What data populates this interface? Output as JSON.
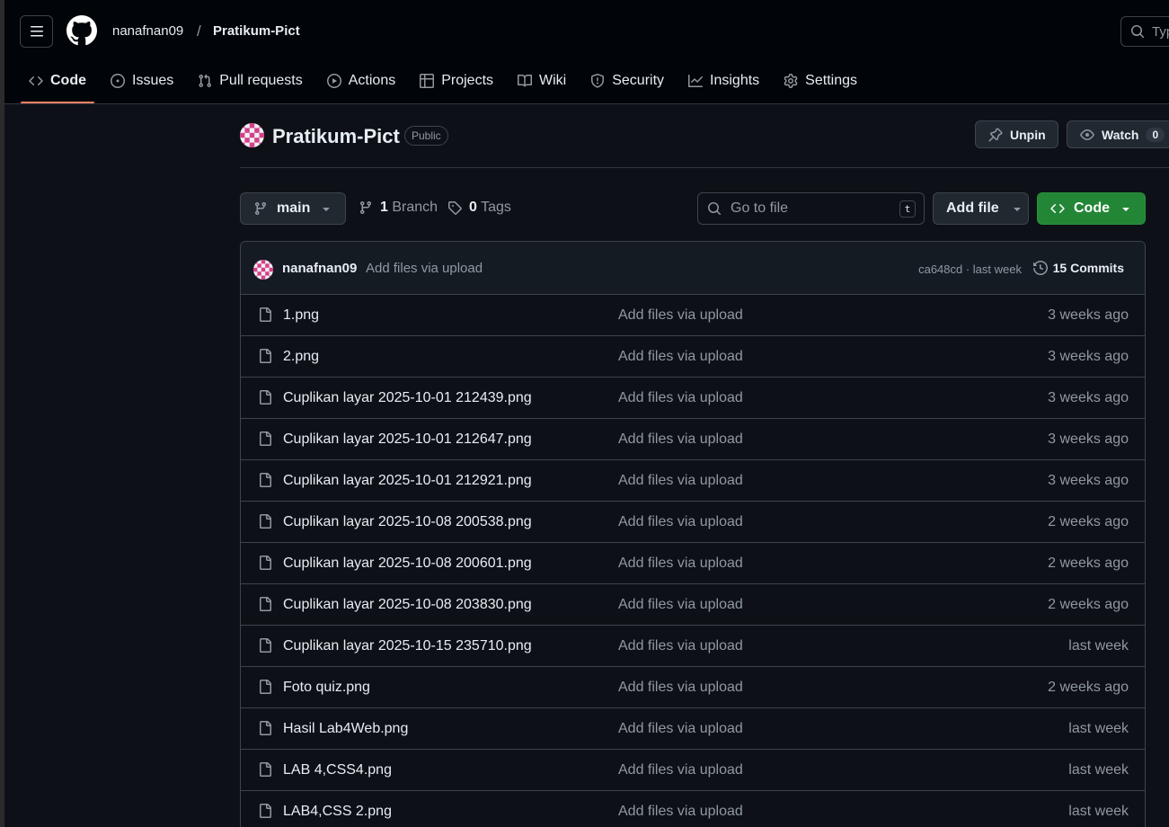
{
  "header": {
    "owner": "nanafnan09",
    "separator": "/",
    "repo": "Pratikum-Pict",
    "search_placeholder": "Typ"
  },
  "tabs": [
    {
      "label": "Code",
      "icon": "code-icon",
      "active": true
    },
    {
      "label": "Issues",
      "icon": "issue-icon"
    },
    {
      "label": "Pull requests",
      "icon": "pull-request-icon"
    },
    {
      "label": "Actions",
      "icon": "play-icon"
    },
    {
      "label": "Projects",
      "icon": "table-icon"
    },
    {
      "label": "Wiki",
      "icon": "book-icon"
    },
    {
      "label": "Security",
      "icon": "shield-icon"
    },
    {
      "label": "Insights",
      "icon": "graph-icon"
    },
    {
      "label": "Settings",
      "icon": "gear-icon"
    }
  ],
  "repo_header": {
    "title": "Pratikum-Pict",
    "visibility": "Public",
    "unpin_label": "Unpin",
    "watch_label": "Watch",
    "watch_count": "0"
  },
  "toolbar": {
    "branch": "main",
    "branch_count": "1",
    "branch_label": "Branch",
    "tag_count": "0",
    "tag_label": "Tags",
    "goto_placeholder": "Go to file",
    "goto_shortcut": "t",
    "add_file_label": "Add file",
    "code_label": "Code"
  },
  "latest_commit": {
    "author": "nanafnan09",
    "message": "Add files via upload",
    "hash_time": "ca648cd · last week",
    "commits_label": "15 Commits"
  },
  "files": [
    {
      "name": "1.png",
      "message": "Add files via upload",
      "age": "3 weeks ago"
    },
    {
      "name": "2.png",
      "message": "Add files via upload",
      "age": "3 weeks ago"
    },
    {
      "name": "Cuplikan layar 2025-10-01 212439.png",
      "message": "Add files via upload",
      "age": "3 weeks ago"
    },
    {
      "name": "Cuplikan layar 2025-10-01 212647.png",
      "message": "Add files via upload",
      "age": "3 weeks ago"
    },
    {
      "name": "Cuplikan layar 2025-10-01 212921.png",
      "message": "Add files via upload",
      "age": "3 weeks ago"
    },
    {
      "name": "Cuplikan layar 2025-10-08 200538.png",
      "message": "Add files via upload",
      "age": "2 weeks ago"
    },
    {
      "name": "Cuplikan layar 2025-10-08 200601.png",
      "message": "Add files via upload",
      "age": "2 weeks ago"
    },
    {
      "name": "Cuplikan layar 2025-10-08 203830.png",
      "message": "Add files via upload",
      "age": "2 weeks ago"
    },
    {
      "name": "Cuplikan layar 2025-10-15 235710.png",
      "message": "Add files via upload",
      "age": "last week"
    },
    {
      "name": "Foto quiz.png",
      "message": "Add files via upload",
      "age": "2 weeks ago"
    },
    {
      "name": "Hasil Lab4Web.png",
      "message": "Add files via upload",
      "age": "last week"
    },
    {
      "name": "LAB 4,CSS4.png",
      "message": "Add files via upload",
      "age": "last week"
    },
    {
      "name": "LAB4,CSS 2.png",
      "message": "Add files via upload",
      "age": "last week"
    }
  ],
  "colors": {
    "background": "#0d1117",
    "header_bg": "#010409",
    "accent_underline": "#f78166",
    "code_button": "#238636",
    "avatar_pink": "#d63f8c"
  }
}
